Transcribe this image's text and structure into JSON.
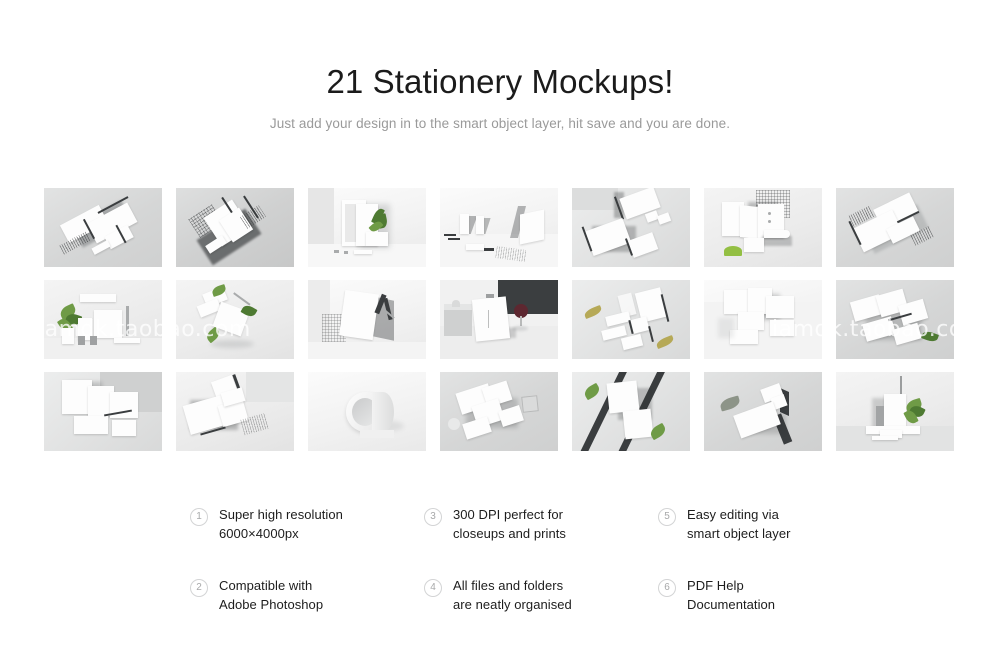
{
  "header": {
    "title": "21 Stationery Mockups!",
    "subtitle": "Just add your design in to the smart object layer, hit save and you are done."
  },
  "watermark": {
    "left": "iamdk.taobao.com",
    "right": "iamdk.taobao.com"
  },
  "gallery": {
    "columns": 7,
    "rows": 3,
    "count": 21,
    "items": [
      {
        "id": 1,
        "name": "flat-lay-stationery-set",
        "tone": "grey"
      },
      {
        "id": 2,
        "name": "angled-paper-stack-halftone",
        "tone": "dark"
      },
      {
        "id": 3,
        "name": "framed-poster-with-plant",
        "tone": "white"
      },
      {
        "id": 4,
        "name": "standing-cards-bright-scene",
        "tone": "white"
      },
      {
        "id": 5,
        "name": "desk-corner-business-cards",
        "tone": "soft"
      },
      {
        "id": 6,
        "name": "grid-backdrop-folder-leaf",
        "tone": "light"
      },
      {
        "id": 7,
        "name": "isometric-letterhead-layout",
        "tone": "grey"
      },
      {
        "id": 8,
        "name": "podium-plant-stationery",
        "tone": "light"
      },
      {
        "id": 9,
        "name": "floating-cards-with-leaves",
        "tone": "light"
      },
      {
        "id": 10,
        "name": "tilted-poster-grid-wall",
        "tone": "white"
      },
      {
        "id": 11,
        "name": "dark-scene-wine-glass-menu",
        "tone": "dark"
      },
      {
        "id": 12,
        "name": "overhead-set-golden-leaves",
        "tone": "soft"
      },
      {
        "id": 13,
        "name": "white-blocks-floating-paper",
        "tone": "white"
      },
      {
        "id": 14,
        "name": "scattered-cards-with-leaf",
        "tone": "grey"
      },
      {
        "id": 15,
        "name": "corner-wall-branding-set",
        "tone": "soft"
      },
      {
        "id": 16,
        "name": "stacked-papers-halftone-panel",
        "tone": "light"
      },
      {
        "id": 17,
        "name": "paper-roll-cylinder",
        "tone": "white"
      },
      {
        "id": 18,
        "name": "floating-frames-with-cube",
        "tone": "grey"
      },
      {
        "id": 19,
        "name": "diagonal-bars-green-leaves",
        "tone": "soft"
      },
      {
        "id": 20,
        "name": "minimal-envelope-leaf-shadow",
        "tone": "grey"
      },
      {
        "id": 21,
        "name": "pedestal-display-monstera",
        "tone": "light"
      }
    ]
  },
  "features": [
    {
      "number": "1",
      "line1": "Super high resolution",
      "line2": "6000×4000px"
    },
    {
      "number": "2",
      "line1": "Compatible with",
      "line2": "Adobe Photoshop"
    },
    {
      "number": "3",
      "line1": "300 DPI perfect for",
      "line2": "closeups and prints"
    },
    {
      "number": "4",
      "line1": "All files and folders",
      "line2": "are neatly organised"
    },
    {
      "number": "5",
      "line1": "Easy editing via",
      "line2": "smart object layer"
    },
    {
      "number": "6",
      "line1": "PDF Help",
      "line2": "Documentation"
    }
  ],
  "colors": {
    "background": "#ffffff",
    "title": "#1b1b1b",
    "subtitle": "#9a9a9a",
    "badge_border": "#d3d4d5",
    "badge_text": "#a7a8a9",
    "feature_text": "#1d1d1d",
    "watermark": "#ffffff"
  }
}
